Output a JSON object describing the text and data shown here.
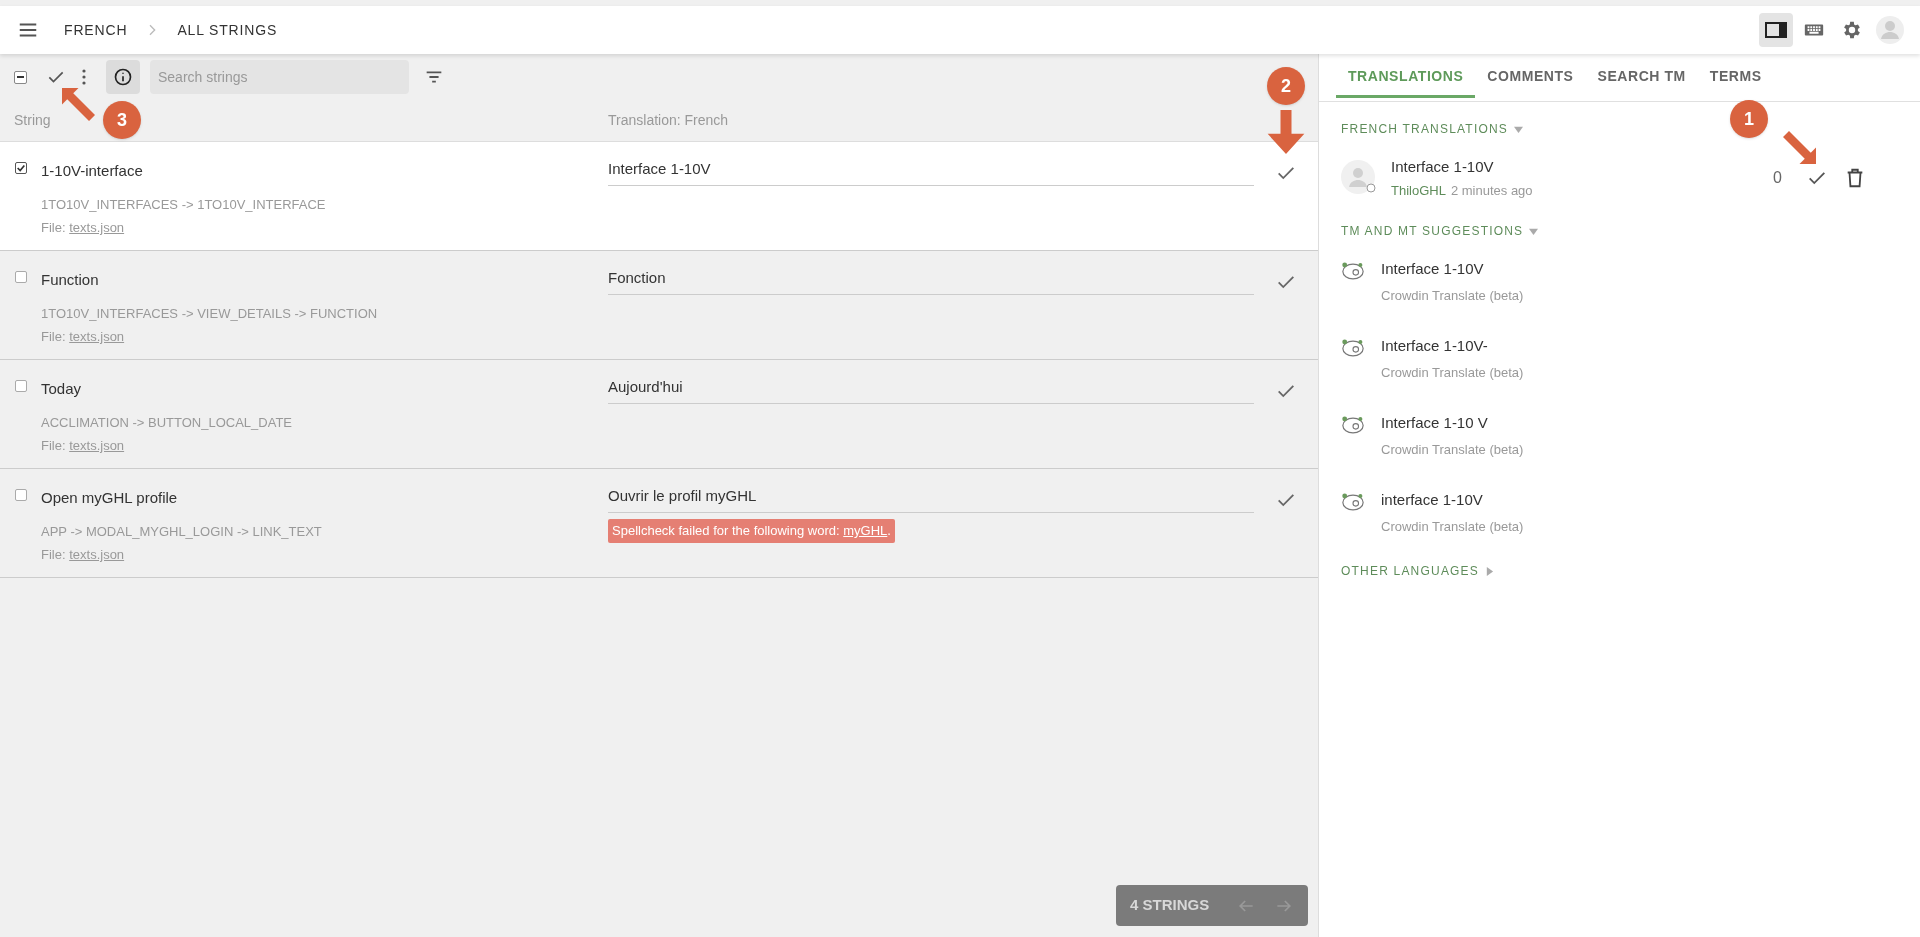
{
  "breadcrumb": [
    "FRENCH",
    "ALL STRINGS"
  ],
  "header_icons": [
    {
      "kind": "layout",
      "selected": true
    },
    {
      "kind": "keyboard",
      "selected": false
    },
    {
      "kind": "settings",
      "selected": false
    },
    {
      "kind": "avatar",
      "selected": false
    }
  ],
  "toolbar": {
    "select_all_indeterminate": true,
    "info_active": true,
    "search": {
      "placeholder": "Search strings"
    }
  },
  "columns": [
    "String",
    "Translation: French"
  ],
  "rows": [
    {
      "source": "1-10V-interface",
      "key": "1TO10V_INTERFACES -> 1TO10V_INTERFACE",
      "file_label": "File:",
      "file": "texts.json",
      "translation": "Interface 1-10V",
      "checked": true,
      "selected": true
    },
    {
      "source": "Function",
      "key": "1TO10V_INTERFACES -> VIEW_DETAILS -> FUNCTION",
      "file_label": "File:",
      "file": "texts.json",
      "translation": "Fonction",
      "checked": false,
      "selected": false
    },
    {
      "source": "Today",
      "key": "ACCLIMATION -> BUTTON_LOCAL_DATE",
      "file_label": "File:",
      "file": "texts.json",
      "translation": "Aujourd'hui",
      "checked": false,
      "selected": false
    },
    {
      "source": "Open myGHL profile",
      "key": "APP -> MODAL_MYGHL_LOGIN -> LINK_TEXT",
      "file_label": "File:",
      "file": "texts.json",
      "translation": "Ouvrir le profil myGHL",
      "checked": false,
      "selected": false,
      "error": {
        "text": "Spellcheck failed for the following word:",
        "word": "myGHL",
        "end": "."
      }
    }
  ],
  "pager": {
    "count": "4 STRINGS"
  },
  "tabs": [
    {
      "label": "TRANSLATIONS",
      "selected": true
    },
    {
      "label": "COMMENTS",
      "selected": false
    },
    {
      "label": "SEARCH TM",
      "selected": false
    },
    {
      "label": "TERMS",
      "selected": false
    }
  ],
  "french_translations": {
    "title": "FRENCH TRANSLATIONS",
    "items": [
      {
        "text": "Interface 1-10V",
        "author": "ThiloGHL",
        "time": "2 minutes ago",
        "votes": "0"
      }
    ]
  },
  "suggestions": {
    "title": "TM AND MT SUGGESTIONS",
    "items": [
      {
        "text": "Interface 1-10V",
        "source": "Crowdin Translate (beta)"
      },
      {
        "text": "Interface 1-10V-",
        "source": "Crowdin Translate (beta)"
      },
      {
        "text": "Interface 1-10 V",
        "source": "Crowdin Translate (beta)"
      },
      {
        "text": "interface 1-10V",
        "source": "Crowdin Translate (beta)"
      }
    ]
  },
  "other_languages": {
    "title": "OTHER LANGUAGES",
    "expanded": false
  },
  "annotations": [
    {
      "label": "1"
    },
    {
      "label": "2"
    },
    {
      "label": "3"
    }
  ]
}
